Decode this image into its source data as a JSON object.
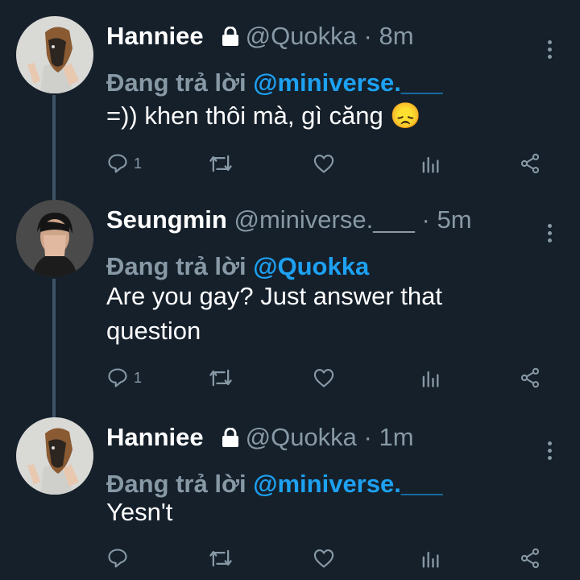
{
  "colors": {
    "background": "#15202b",
    "text": "#ffffff",
    "muted": "#8899a6",
    "mention": "#1da1f2",
    "thread_line": "#3d5466"
  },
  "icons": [
    "lock-icon",
    "more-icon",
    "reply-icon",
    "retweet-icon",
    "like-icon",
    "analytics-icon",
    "share-icon"
  ],
  "tweets": [
    {
      "name": "Hanniee",
      "locked": true,
      "handle": "@Quokka",
      "separator": "·",
      "time": "8m",
      "reply_prefix": "Đang trả lời",
      "reply_to": "@miniverse.___",
      "text": "=)) khen thôi mà, gì căng 😞",
      "reply_count": "1"
    },
    {
      "name": "Seungmin",
      "locked": false,
      "handle": "@miniverse.___",
      "separator": "·",
      "time": "5m",
      "reply_prefix": "Đang trả lời",
      "reply_to": "@Quokka",
      "text": "Are you gay? Just answer that question",
      "reply_count": "1"
    },
    {
      "name": "Hanniee",
      "locked": true,
      "handle": "@Quokka",
      "separator": "·",
      "time": "1m",
      "reply_prefix": "Đang trả lời",
      "reply_to": "@miniverse.___",
      "text": "Yesn't",
      "reply_count": ""
    }
  ]
}
